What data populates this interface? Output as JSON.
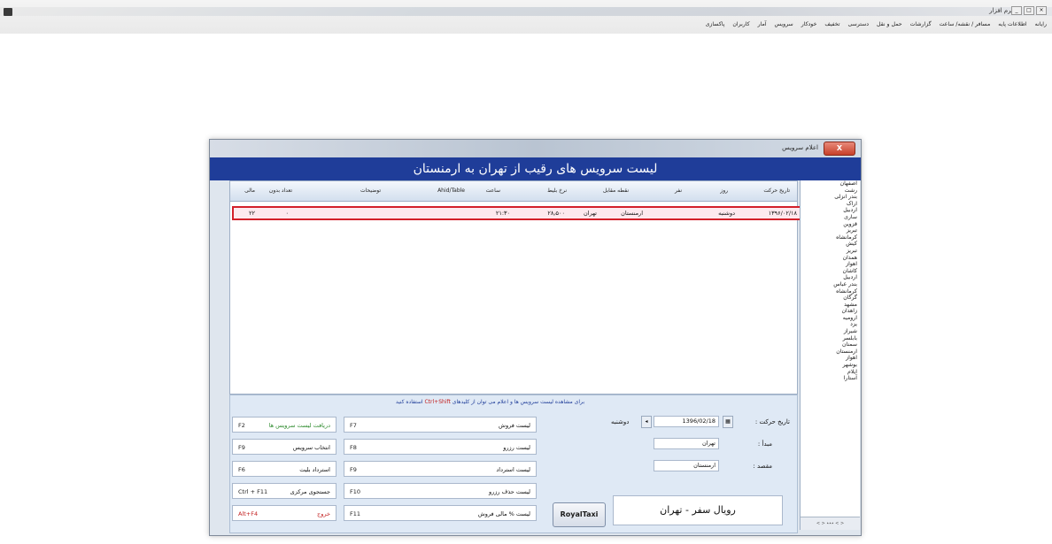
{
  "app": {
    "title": "نرم افزار",
    "menu": [
      "رایانه",
      "اطلاعات پایه",
      "مسافر / نقشه/ ساعت",
      "گزارشات",
      "حمل و نقل",
      "دسترسی",
      "تخفیف",
      "خودکار",
      "سرویس",
      "آمار",
      "کاربران",
      "پاکسازی"
    ]
  },
  "dialog": {
    "title": "اعلام سرویس",
    "close_label": "X",
    "header": "لیست سرویس های رقیب از تهران به ارمنستان"
  },
  "grid": {
    "columns": [
      "تاریخ حرکت",
      "روز",
      "نفر",
      "نقطه مقابل",
      "نرخ بلیط",
      "ساعت",
      "Ahid/Table",
      "توضیحات",
      "تعداد بدون",
      "مالی"
    ],
    "row": [
      "۱۳۹۶/۰۲/۱۸",
      "دوشنبه",
      "ارمنستان",
      "تهران",
      "۲۸٫۵۰۰",
      "۲۱:۳۰",
      "",
      "",
      "۰",
      "۲۲"
    ]
  },
  "sidebar": {
    "items": [
      "اصفهان",
      "رشت",
      "بندر انزلی",
      "اراک",
      "اردبیل",
      "ساری",
      "قزوین",
      "تبریز",
      "کرمانشاه",
      "کیش",
      "تبریز",
      "همدان",
      "اهواز",
      "کاشان",
      "اردبیل",
      "بندر عباس",
      "کرمانشاه",
      "گرگان",
      "مشهد",
      "زاهدان",
      "ارومیه",
      "یزد",
      "شیراز",
      "بابلسر",
      "سمنان",
      "ارمنستان",
      "اهواز",
      "بوشهر",
      "ایلام",
      "آستارا"
    ],
    "scroll_text": "< > ٭٭٭ < >"
  },
  "bottom": {
    "note": "برای مشاهده لیست سرویس ها و اعلام می توان از کلیدهای",
    "note_key": "Ctrl+Shift",
    "note_tail": "استفاده کنید",
    "buttons_left": [
      {
        "label": "دریافت لیست سرویس ها",
        "key": "F2"
      },
      {
        "label": "انتخاب سرویس",
        "key": "F9"
      },
      {
        "label": "استرداد بلیت",
        "key": "F6"
      },
      {
        "label": "جستجوی مرکزی",
        "key": "Ctrl + F11"
      },
      {
        "label": "خروج",
        "key": "Alt+F4"
      }
    ],
    "buttons_mid": [
      {
        "label": "لیست فروش",
        "key": "F7"
      },
      {
        "label": "لیست رزرو",
        "key": "F8"
      },
      {
        "label": "لیست استرداد",
        "key": "F9"
      },
      {
        "label": "لیست حذف رزرو",
        "key": "F10"
      },
      {
        "label": "لیست % مالی فروش",
        "key": "F11"
      }
    ],
    "royal_button": "RoyalTaxi",
    "company": "رویال سفر - تهران",
    "departure_label": "تاریخ حرکت :",
    "departure_date": "1396/02/18",
    "departure_day": "دوشنبه",
    "origin_label": "مبدأ :",
    "origin_value": "تهران",
    "destination_label": "مقصد :",
    "destination_value": "ارمنستان"
  }
}
